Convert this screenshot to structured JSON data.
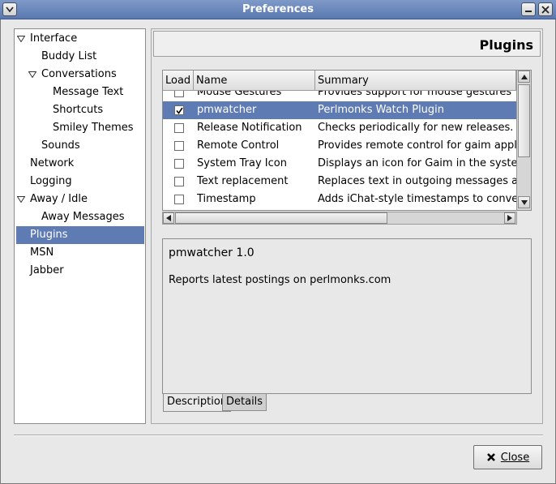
{
  "window": {
    "title": "Preferences"
  },
  "sidebar": {
    "items": [
      {
        "label": "Interface",
        "level": 0,
        "expanded": true
      },
      {
        "label": "Buddy List",
        "level": 1
      },
      {
        "label": "Conversations",
        "level": 1,
        "expanded": true
      },
      {
        "label": "Message Text",
        "level": 2
      },
      {
        "label": "Shortcuts",
        "level": 2
      },
      {
        "label": "Smiley Themes",
        "level": 2
      },
      {
        "label": "Sounds",
        "level": 1
      },
      {
        "label": "Network",
        "level": 0
      },
      {
        "label": "Logging",
        "level": 0
      },
      {
        "label": "Away / Idle",
        "level": 0,
        "expanded": true
      },
      {
        "label": "Away Messages",
        "level": 1
      },
      {
        "label": "Plugins",
        "level": 0,
        "selected": true
      },
      {
        "label": "MSN",
        "level": 0
      },
      {
        "label": "Jabber",
        "level": 0
      }
    ]
  },
  "panel": {
    "heading": "Plugins"
  },
  "plugin_list": {
    "columns": [
      "Load",
      "Name",
      "Summary"
    ],
    "rows": [
      {
        "load": false,
        "name": "Mouse Gestures",
        "summary": "Provides support for mouse gestures",
        "selected": false
      },
      {
        "load": true,
        "name": "pmwatcher",
        "summary": "Perlmonks Watch Plugin",
        "selected": true
      },
      {
        "load": false,
        "name": "Release Notification",
        "summary": "Checks periodically for new releases.",
        "selected": false
      },
      {
        "load": false,
        "name": "Remote Control",
        "summary": "Provides remote control for gaim applicatio",
        "selected": false
      },
      {
        "load": false,
        "name": "System Tray Icon",
        "summary": "Displays an icon for Gaim in the system tr",
        "selected": false
      },
      {
        "load": false,
        "name": "Text replacement",
        "summary": "Replaces text in outgoing messages acco",
        "selected": false
      },
      {
        "load": false,
        "name": "Timestamp",
        "summary": "Adds iChat-style timestamps to conversat",
        "selected": false
      }
    ]
  },
  "description": {
    "title": "pmwatcher 1.0",
    "text": "Reports latest postings on perlmonks.com"
  },
  "tabs": {
    "description": "Description",
    "details": "Details"
  },
  "buttons": {
    "close": "Close"
  },
  "icons": {
    "menu": "chevron-down-icon",
    "minimize": "minimize-icon",
    "close_window": "close-icon",
    "close_button": "x-icon"
  },
  "colors": {
    "selection": "#5f7bb4",
    "titlebar": "#6884bc"
  }
}
